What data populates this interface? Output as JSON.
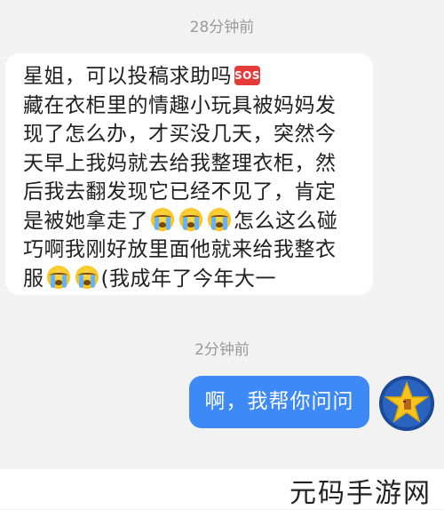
{
  "chat": {
    "timestamp_1": "28分钟前",
    "incoming": {
      "line1": "星姐，可以投稿求助吗",
      "sos_badge": "SOS",
      "line2": "藏在衣柜里的情趣小玩具被妈妈发",
      "line3": "现了怎么办，才买没几天，突然今",
      "line4": "天早上我妈就去给我整理衣柜，然",
      "line5": "后我去翻发现它已经不见了，肯定",
      "line6a": "是被她拿走了",
      "line6b": "怎么这么碰",
      "line7": "巧啊我刚好放里面他就来给我整衣",
      "line8a": "服",
      "line8b": "(我成年了今年大一"
    },
    "timestamp_2": "2分钟前",
    "outgoing": {
      "text": "啊，我帮你问问"
    }
  },
  "icons": {
    "sos": "sos-emoji",
    "crying_face": "loudly-crying-face-emoji",
    "avatar": "star-avatar"
  },
  "colors": {
    "background": "#f2f2f2",
    "incoming_bubble": "#ffffff",
    "outgoing_bubble": "#3d8af7",
    "timestamp": "#9a9a9a"
  },
  "watermark": {
    "text": "元码手游网"
  }
}
